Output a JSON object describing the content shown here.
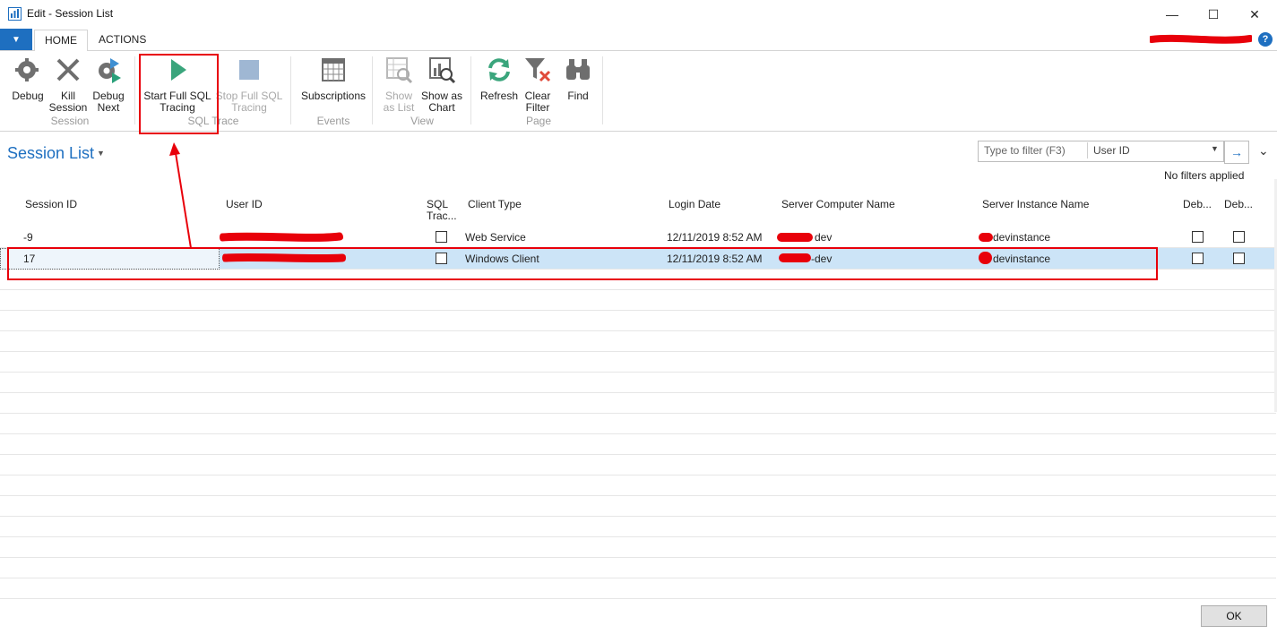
{
  "window": {
    "title": "Edit - Session List",
    "minimize": "—",
    "maximize": "☐",
    "close": "✕"
  },
  "ribbon_tabs": [
    {
      "label": "HOME"
    },
    {
      "label": "ACTIONS"
    }
  ],
  "help": "?",
  "ribbon": {
    "groups": [
      {
        "label": "Session"
      },
      {
        "label": "SQL Trace"
      },
      {
        "label": "Events"
      },
      {
        "label": "View"
      },
      {
        "label": "Page"
      }
    ],
    "buttons": {
      "debug": [
        "Debug",
        ""
      ],
      "kill_session": [
        "Kill",
        "Session"
      ],
      "debug_next": [
        "Debug",
        "Next"
      ],
      "start_trace": [
        "Start Full SQL",
        "Tracing"
      ],
      "stop_trace": [
        "Stop Full SQL",
        "Tracing"
      ],
      "subscriptions": [
        "Subscriptions",
        ""
      ],
      "show_as_list": [
        "Show",
        "as List"
      ],
      "show_as_chart": [
        "Show as",
        "Chart"
      ],
      "refresh": [
        "Refresh",
        ""
      ],
      "clear_filter": [
        "Clear",
        "Filter"
      ],
      "find": [
        "Find",
        ""
      ]
    }
  },
  "page": {
    "title": "Session List"
  },
  "filter": {
    "placeholder": "Type to filter (F3)",
    "field": "User ID",
    "status": "No filters applied"
  },
  "columns": {
    "session_id": "Session ID",
    "user_id": "User ID",
    "sql_trace_1": "SQL",
    "sql_trace_2": "Trac...",
    "client_type": "Client Type",
    "login_date": "Login Date",
    "server_computer": "Server Computer Name",
    "server_instance": "Server Instance Name",
    "deb1": "Deb...",
    "deb2": "Deb..."
  },
  "rows": [
    {
      "session_id": "-9",
      "client_type": "Web Service",
      "login_date": "12/11/2019 8:52 AM",
      "server_computer": "dev",
      "server_instance": "devinstance"
    },
    {
      "session_id": "17",
      "client_type": "Windows Client",
      "login_date": "12/11/2019 8:52 AM",
      "server_computer": "-dev",
      "server_instance": "devinstance"
    }
  ],
  "ok": "OK",
  "colors": {
    "accent": "#1e6fc0",
    "selection": "#cce4f7",
    "annotation": "#e8000a"
  }
}
